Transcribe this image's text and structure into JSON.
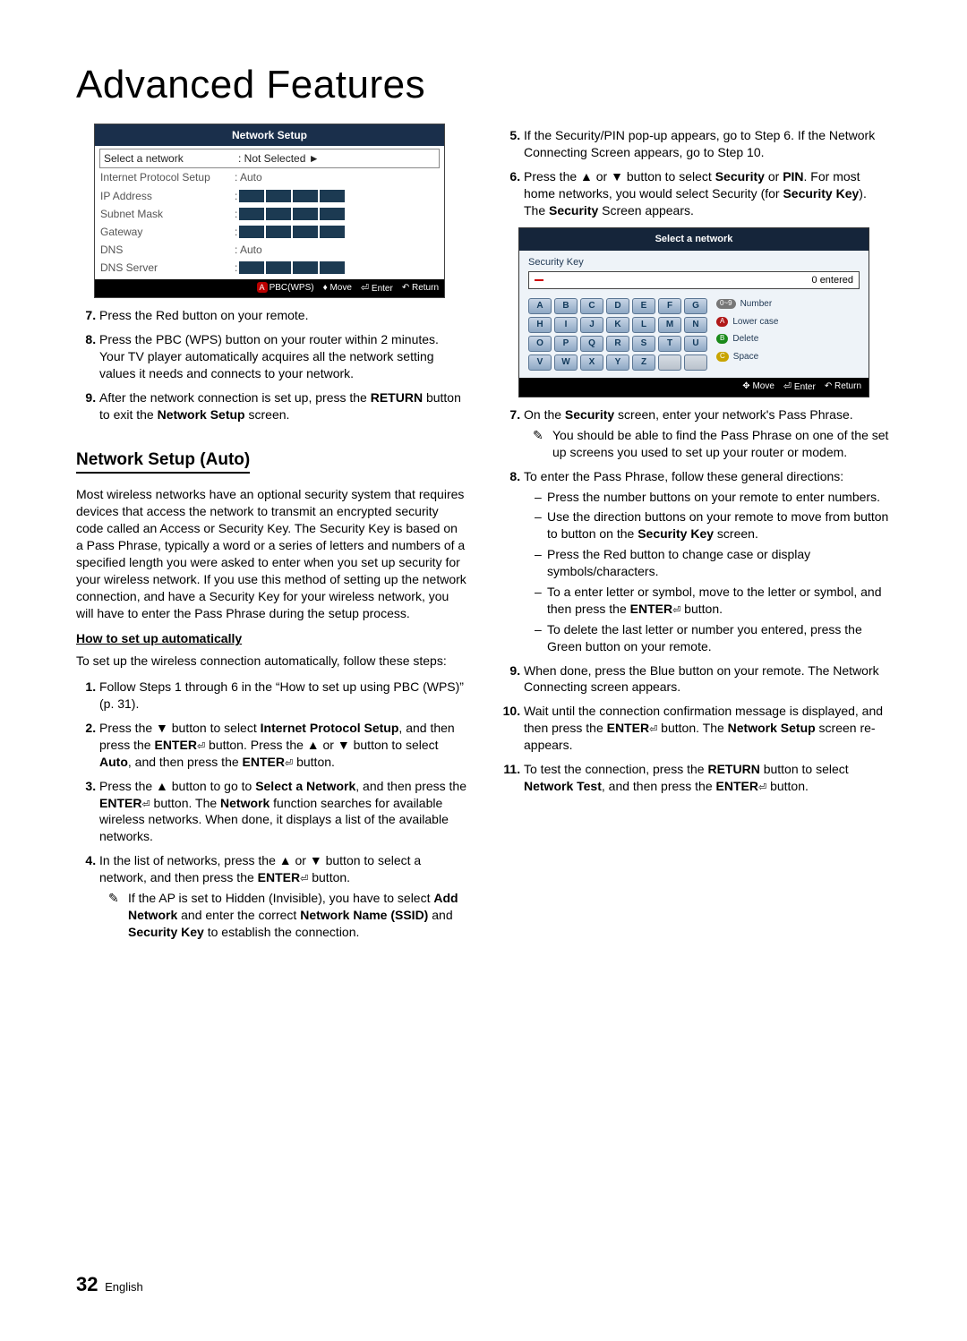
{
  "title": "Advanced Features",
  "networkSetupBox": {
    "title": "Network Setup",
    "rows": {
      "select_label": "Select a network",
      "select_val": ": Not Selected  ►",
      "ips_label": "Internet Protocol Setup",
      "ips_val": ": Auto",
      "ip_label": "IP Address",
      "subnet_label": "Subnet Mask",
      "gateway_label": "Gateway",
      "dns_label": "DNS",
      "dns_val": ": Auto",
      "dnss_label": "DNS Server"
    },
    "foot": {
      "a": "A",
      "pbc": "PBC(WPS)",
      "move": "Move",
      "enter": "Enter",
      "return": "Return"
    }
  },
  "colA_list1": {
    "i7": "Press the Red button on your remote.",
    "i8": "Press the PBC (WPS) button on your router within 2 minutes. Your TV player automatically acquires all the network setting values it needs and connects to your network.",
    "i9_a": "After the network connection is set up, press the ",
    "i9_ret": "RETURN",
    "i9_b": " button to exit the ",
    "i9_ns": "Network Setup",
    "i9_c": " screen."
  },
  "sect_auto": "Network Setup (Auto)",
  "auto_para": "Most wireless networks have an optional security system that requires devices that access the network to transmit an encrypted security code called an Access or Security Key. The Security Key is based on a Pass Phrase, typically a word or a series of letters and numbers of a specified length you were asked to enter when you set up security for your wireless network.  If you use this method of setting up the network connection, and have a Security Key for your wireless network, you will have to enter the Pass Phrase during the setup process.",
  "howto": "How to set up automatically",
  "auto_intro": "To set up the wireless connection automatically, follow these steps:",
  "colA_list2": {
    "i1": "Follow Steps 1 through 6 in the “How to set up using PBC (WPS)” (p. 31).",
    "i2_a": "Press the ▼ button to select ",
    "i2_ips": "Internet Protocol Setup",
    "i2_b": ", and then press the ",
    "i2_enter": "ENTER",
    "i2_c": " button. Press the ▲ or ▼ button to select ",
    "i2_auto": "Auto",
    "i2_d": ", and then press the ",
    "i2_e": " button.",
    "i3_a": "Press the ▲ button to go to ",
    "i3_san": "Select a Network",
    "i3_b": ", and then press the ",
    "i3_c": " button. The ",
    "i3_net": "Network",
    "i3_d": " function searches for available wireless networks. When done, it displays a list of the available networks.",
    "i4_a": "In the list of networks, press the ▲ or ▼ button to select a network, and then press the ",
    "i4_b": " button.",
    "note_a": "If the AP is set to Hidden (Invisible), you have to select ",
    "note_add": "Add Network",
    "note_b": " and enter the correct ",
    "note_ssid": "Network Name (SSID)",
    "note_c": " and ",
    "note_sk": "Security Key",
    "note_d": " to establish the connection."
  },
  "colB_top": {
    "i5": "If the Security/PIN pop-up appears, go to Step 6. If the Network Connecting Screen appears, go to Step 10.",
    "i6_a": "Press the ▲ or ▼ button to select ",
    "i6_sec": "Security",
    "i6_or": " or ",
    "i6_pin": "PIN",
    "i6_b": ". For most home networks, you would select Security (for ",
    "i6_sk": "Security Key",
    "i6_c": "). The ",
    "i6_secscr": "Security",
    "i6_d": " Screen appears."
  },
  "kb": {
    "title": "Select a network",
    "seclabel": "Security Key",
    "entered": "0 entered",
    "letters": [
      "A",
      "B",
      "C",
      "D",
      "E",
      "F",
      "G",
      "H",
      "I",
      "J",
      "K",
      "L",
      "M",
      "N",
      "O",
      "P",
      "Q",
      "R",
      "S",
      "T",
      "U",
      "V",
      "W",
      "X",
      "Y",
      "Z",
      "",
      ""
    ],
    "legend": {
      "num": "Number",
      "lower": "Lower case",
      "del": "Delete",
      "space": "Space"
    },
    "foot": {
      "move": "Move",
      "enter": "Enter",
      "return": "Return"
    }
  },
  "colB_list2": {
    "i7_a": "On the ",
    "i7_sec": "Security",
    "i7_b": " screen, enter your network's Pass Phrase.",
    "note7": "You should be able to find the Pass Phrase on one of the set up screens you used to set up your router or modem.",
    "i8": "To enter the Pass Phrase, follow these general directions:",
    "i8s": {
      "s1": "Press the number buttons on your remote to enter numbers.",
      "s2_a": "Use the direction buttons on your remote to move from button to button on the ",
      "s2_sk": "Security Key",
      "s2_b": " screen.",
      "s3": "Press the Red button to change case or display symbols/characters.",
      "s4_a": "To a enter letter or symbol, move to the letter or symbol, and then press the ",
      "s4_enter": "ENTER",
      "s4_b": " button.",
      "s5": "To delete the last letter or number you entered, press the Green button on your remote."
    },
    "i9": "When done, press the Blue button on your remote. The Network Connecting screen appears.",
    "i10_a": "Wait until the connection confirmation message is displayed, and then press the ",
    "i10_b": " button. The ",
    "i10_ns": "Network Setup",
    "i10_c": " screen re-appears.",
    "i11_a": "To test the connection, press the ",
    "i11_ret": "RETURN",
    "i11_b": " button to select ",
    "i11_nt": "Network Test",
    "i11_c": ", and then press the ",
    "i11_d": " button."
  },
  "footer": {
    "page": "32",
    "lang": "English"
  }
}
